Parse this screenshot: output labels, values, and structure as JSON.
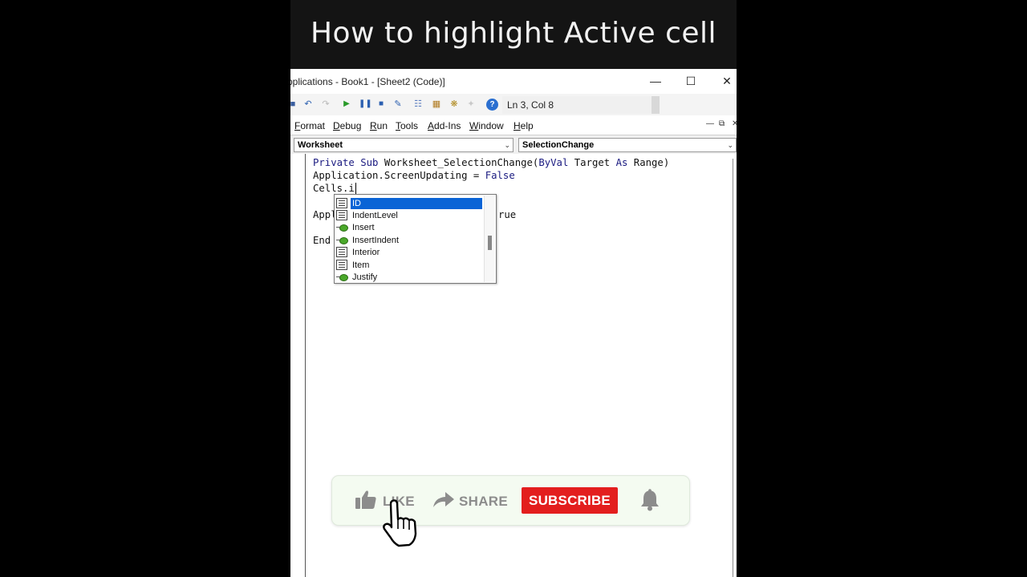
{
  "banner": {
    "title": "How to highlight Active cell"
  },
  "window": {
    "title": "pplications - Book1 - [Sheet2 (Code)]",
    "status": "Ln 3, Col 8"
  },
  "menu": {
    "items": [
      {
        "label": "Format",
        "u": "F",
        "rest": "ormat"
      },
      {
        "label": "Debug",
        "u": "D",
        "rest": "ebug"
      },
      {
        "label": "Run",
        "u": "R",
        "rest": "un"
      },
      {
        "label": "Tools",
        "u": "T",
        "rest": "ools"
      },
      {
        "label": "Add-Ins",
        "u": "A",
        "rest": "dd-Ins"
      },
      {
        "label": "Window",
        "u": "W",
        "rest": "indow"
      },
      {
        "label": "Help",
        "u": "H",
        "rest": "elp"
      }
    ]
  },
  "object_combo": {
    "value": "Worksheet"
  },
  "procedure_combo": {
    "value": "SelectionChange"
  },
  "code": {
    "line1_kw": "Private Sub",
    "line1_rest": " Worksheet_SelectionChange(",
    "line1_kw2": "ByVal",
    "line1_rest2": " Target ",
    "line1_kw3": "As",
    "line1_rest3": " Range)",
    "line2_a": "Application.ScreenUpdating = ",
    "line2_kw": "False",
    "line3": "Cells.i",
    "line4_left": "Appl",
    "line4_right": "rue",
    "line5_left": "End"
  },
  "autocomplete": {
    "items": [
      {
        "label": "ID",
        "kind": "property",
        "selected": true
      },
      {
        "label": "IndentLevel",
        "kind": "property",
        "selected": false
      },
      {
        "label": "Insert",
        "kind": "method",
        "selected": false
      },
      {
        "label": "InsertIndent",
        "kind": "method",
        "selected": false
      },
      {
        "label": "Interior",
        "kind": "property",
        "selected": false
      },
      {
        "label": "Item",
        "kind": "property",
        "selected": false
      },
      {
        "label": "Justify",
        "kind": "method",
        "selected": false
      }
    ]
  },
  "overlay": {
    "like": "LIKE",
    "share": "SHARE",
    "subscribe": "SUBSCRIBE",
    "subscribe_color": "#e31e1e"
  }
}
